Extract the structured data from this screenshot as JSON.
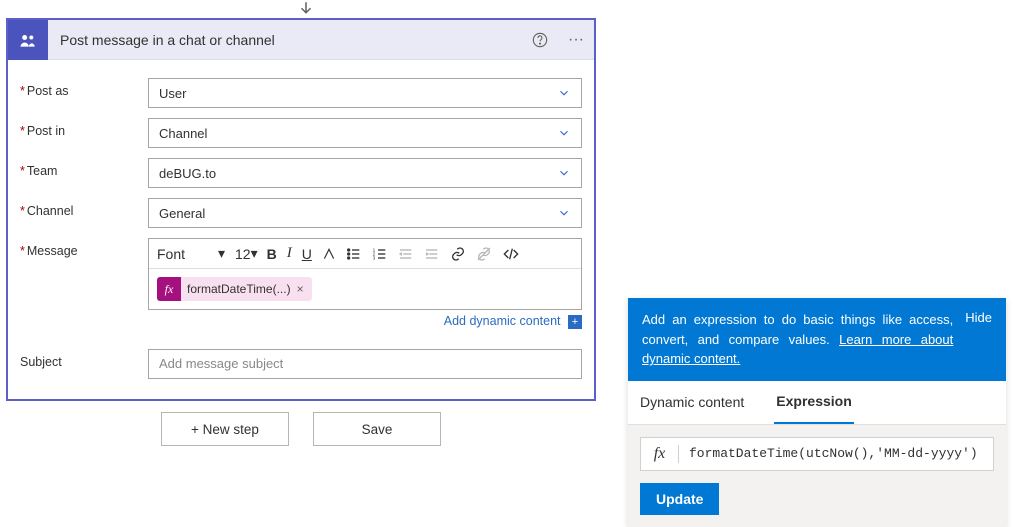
{
  "arrow_glyph": "↓",
  "header": {
    "title": "Post message in a chat or channel",
    "help_glyph": "?",
    "dots_glyph": "···"
  },
  "fields": {
    "post_as": {
      "label": "Post as",
      "value": "User"
    },
    "post_in": {
      "label": "Post in",
      "value": "Channel"
    },
    "team": {
      "label": "Team",
      "value": "deBUG.to"
    },
    "channel": {
      "label": "Channel",
      "value": "General"
    },
    "message": {
      "label": "Message"
    },
    "subject": {
      "label": "Subject",
      "placeholder": "Add message subject"
    }
  },
  "toolbar": {
    "font": "Font",
    "size": "12",
    "bold": "B",
    "italic": "I",
    "underline": "U"
  },
  "message_pill": {
    "fx": "fx",
    "text": "formatDateTime(...)",
    "close": "×"
  },
  "dynamic_link": {
    "text": "Add dynamic content",
    "plus": "+"
  },
  "buttons": {
    "new_step": "+ New step",
    "save": "Save"
  },
  "panel": {
    "banner_text": "Add an expression to do basic things like access, convert, and compare values. ",
    "banner_link": "Learn more about dynamic content.",
    "hide": "Hide",
    "tabs": {
      "dynamic": "Dynamic content",
      "expression": "Expression"
    },
    "fx": "fx",
    "expression": "formatDateTime(utcNow(),'MM-dd-yyyy')",
    "update": "Update"
  },
  "caret_glyph": "⌄"
}
